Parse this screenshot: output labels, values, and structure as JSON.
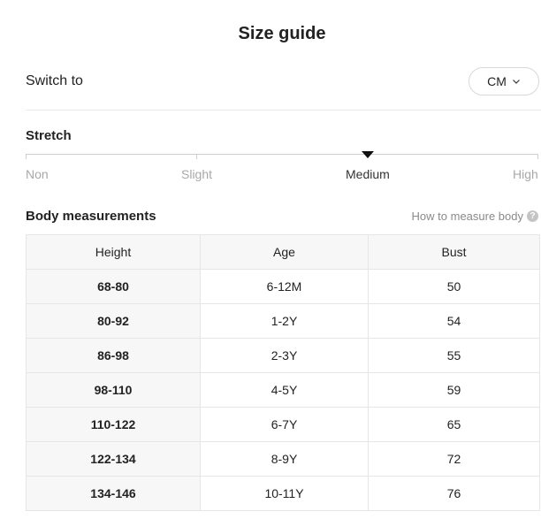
{
  "title": "Size guide",
  "switch": {
    "label": "Switch to",
    "unit": "CM"
  },
  "stretch": {
    "label": "Stretch",
    "levels": [
      "Non",
      "Slight",
      "Medium",
      "High"
    ],
    "selected": "Medium"
  },
  "body_measurements": {
    "title": "Body measurements",
    "help_link": "How to measure body",
    "help_icon": "question-icon",
    "columns": [
      "Height",
      "Age",
      "Bust"
    ],
    "rows": [
      [
        "68-80",
        "6-12M",
        "50"
      ],
      [
        "80-92",
        "1-2Y",
        "54"
      ],
      [
        "86-98",
        "2-3Y",
        "55"
      ],
      [
        "98-110",
        "4-5Y",
        "59"
      ],
      [
        "110-122",
        "6-7Y",
        "65"
      ],
      [
        "122-134",
        "8-9Y",
        "72"
      ],
      [
        "134-146",
        "10-11Y",
        "76"
      ]
    ]
  }
}
